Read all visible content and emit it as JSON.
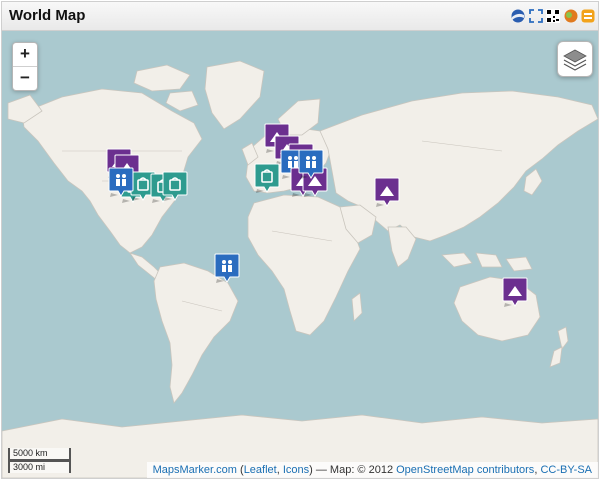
{
  "title": "World Map",
  "toolbar_icons": [
    "google-earth-icon",
    "fullscreen-icon",
    "qr-code-icon",
    "geo-rss-icon",
    "wikitude-icon"
  ],
  "zoom": {
    "in_label": "+",
    "out_label": "−"
  },
  "scale": {
    "km": "5000 km",
    "mi": "3000 mi"
  },
  "attribution": {
    "mapsmarker": "MapsMarker.com",
    "open_paren": " (",
    "leaflet": "Leaflet",
    "comma": ", ",
    "icons": "Icons",
    "middle": ") — Map: © 2012 ",
    "osm": "OpenStreetMap contributors",
    "comma2": ", ",
    "license": "CC-BY-SA"
  },
  "colors": {
    "water": "#aac9cf",
    "land": "#f2efe9",
    "border": "#bcbcbc",
    "marker_purple": "#6b2f8f",
    "marker_teal": "#2e9b8f",
    "marker_blue": "#2a6cbf"
  },
  "markers": [
    {
      "icon": "mountain",
      "color": "purple"
    },
    {
      "icon": "mountain",
      "color": "purple"
    },
    {
      "icon": "shopping",
      "color": "teal"
    },
    {
      "icon": "shopping",
      "color": "teal"
    },
    {
      "icon": "shopping",
      "color": "teal"
    },
    {
      "icon": "shopping",
      "color": "teal"
    },
    {
      "icon": "family",
      "color": "blue"
    },
    {
      "icon": "family",
      "color": "blue"
    },
    {
      "icon": "mountain",
      "color": "purple"
    },
    {
      "icon": "mountain",
      "color": "purple"
    },
    {
      "icon": "mountain",
      "color": "purple"
    },
    {
      "icon": "family",
      "color": "blue"
    },
    {
      "icon": "shopping",
      "color": "teal"
    },
    {
      "icon": "mountain",
      "color": "purple"
    },
    {
      "icon": "mountain",
      "color": "purple"
    },
    {
      "icon": "mountain",
      "color": "purple"
    },
    {
      "icon": "family",
      "color": "blue"
    },
    {
      "icon": "mountain",
      "color": "purple"
    }
  ]
}
